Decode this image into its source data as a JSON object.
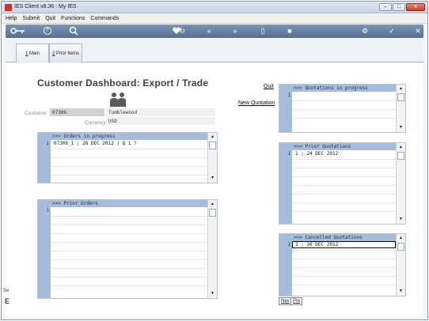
{
  "window": {
    "title": "IES Client v8.36 : My IES"
  },
  "window_controls": {
    "minimize": "–",
    "maximize": "□",
    "close": "x"
  },
  "menubar": {
    "items": [
      "Help",
      "Submit",
      "Quit",
      "Functions",
      "Commands"
    ]
  },
  "toolbar": {
    "icons": [
      "key-icon",
      "help-icon",
      "search-icon",
      "heart-icon",
      "refresh-icon",
      "back-icon",
      "forward-icon",
      "document-icon",
      "stop-icon",
      "settings-icon",
      "check-icon",
      "close-icon"
    ],
    "help_glyph": "?"
  },
  "tabs": [
    {
      "accel": "1",
      "label": " Main"
    },
    {
      "accel": "2",
      "label": " Prior Items"
    }
  ],
  "page": {
    "title": "Customer Dashboard: Export / Trade"
  },
  "links": {
    "quit": "Quit",
    "new_quotation": "New Quotation"
  },
  "customer": {
    "label": "Customer",
    "code": "07306",
    "name": "Tumblewood",
    "currency_label": "Currency",
    "currency": "USD"
  },
  "grids": {
    "orders_in_progress": {
      "header": ">>> Orders in progress",
      "rows": [
        {
          "num": "1",
          "text": "07306_1 ; 26 DEC 2012 ( Q 1 )"
        }
      ]
    },
    "prior_orders": {
      "header": ">>> Prior Orders",
      "rows": [
        {
          "num": "1",
          "text": ""
        }
      ]
    },
    "quotations_in_progress": {
      "header": ">>> Quotations in progress",
      "rows": [
        {
          "num": "1",
          "text": ""
        }
      ]
    },
    "prior_quotations": {
      "header": ">>> Prior Quotations",
      "rows": [
        {
          "num": "1",
          "text": "1 ; 24 DEC 2012"
        }
      ]
    },
    "cancelled_quotations": {
      "header": ">>> Cancelled Quotations",
      "rows": [
        {
          "num": "1",
          "text": "2 ; 26 DEC 2012"
        }
      ]
    }
  },
  "buttons": {
    "next": "Nex",
    "prev": "Pre"
  },
  "side": {
    "stub_top": "Se",
    "stub_bottom": "E"
  },
  "colors": {
    "grid_header": "#a6bcdc",
    "toolbar": "#6b85a8"
  }
}
